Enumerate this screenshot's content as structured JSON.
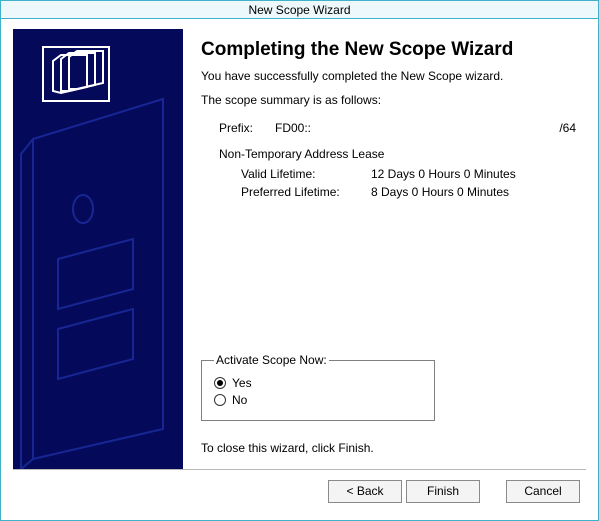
{
  "window": {
    "title": "New Scope Wizard"
  },
  "main": {
    "heading": "Completing the New Scope Wizard",
    "subtext": "You have successfully completed the New Scope wizard.",
    "summary_intro": "The scope summary is as follows:",
    "prefix_label": "Prefix:",
    "prefix_value": "FD00::",
    "prefix_mask": "/64",
    "lease": {
      "title": "Non-Temporary Address Lease",
      "valid_label": "Valid Lifetime:",
      "valid_value": "12 Days 0 Hours 0 Minutes",
      "preferred_label": "Preferred Lifetime:",
      "preferred_value": "8 Days 0 Hours 0 Minutes"
    },
    "activate": {
      "legend": "Activate Scope Now:",
      "yes": "Yes",
      "no": "No",
      "selected": "yes"
    },
    "close_text": "To close this wizard, click Finish."
  },
  "buttons": {
    "back": "< Back",
    "finish": "Finish",
    "cancel": "Cancel"
  }
}
